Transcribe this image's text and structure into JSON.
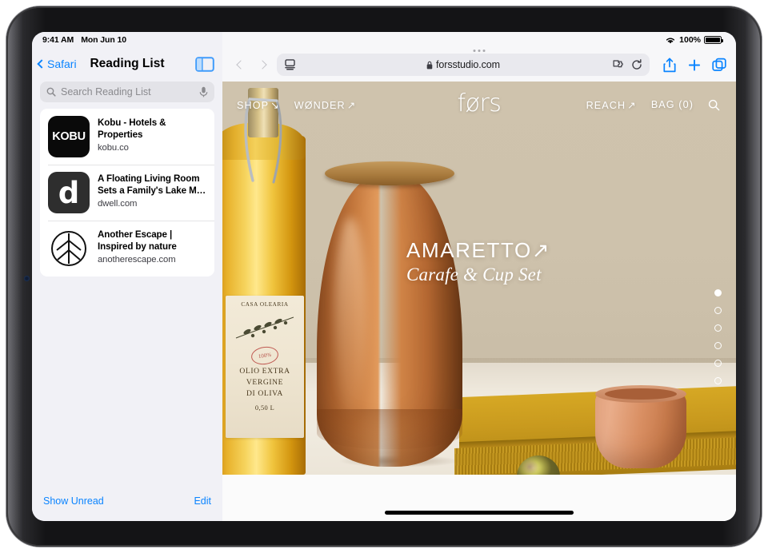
{
  "status_bar": {
    "time": "9:41 AM",
    "date": "Mon Jun 10",
    "battery_percent": "100%",
    "wifi_icon": "wifi-icon",
    "battery_icon": "battery-full-icon"
  },
  "sidebar": {
    "back_label": "Safari",
    "title": "Reading List",
    "toggle_icon": "sidebar-toggle-icon",
    "search": {
      "placeholder": "Search Reading List",
      "value": "",
      "search_icon": "magnifying-glass-icon",
      "dictation_icon": "microphone-icon"
    },
    "items": [
      {
        "title": "Kobu - Hotels & Properties",
        "url": "kobu.co",
        "favicon_text": "KOBU",
        "favicon_name": "kobu-favicon"
      },
      {
        "title": "A Floating Living Room Sets a Family's Lake M…",
        "url": "dwell.com",
        "favicon_text": "d",
        "favicon_name": "dwell-favicon"
      },
      {
        "title": "Another Escape | Inspired by nature",
        "url": "anotherescape.com",
        "favicon_text": "",
        "favicon_name": "another-escape-leaf-favicon"
      }
    ],
    "footer": {
      "show_unread": "Show Unread",
      "edit": "Edit"
    }
  },
  "browser_toolbar": {
    "back_icon": "chevron-left-icon",
    "forward_icon": "chevron-right-icon",
    "page_settings_icon": "aa-page-settings-icon",
    "url": "forsstudio.com",
    "lock_icon": "lock-icon",
    "extensions_icon": "puzzle-piece-icon",
    "reload_icon": "reload-icon",
    "share_icon": "share-icon",
    "new_tab_icon": "plus-icon",
    "tab_overview_icon": "tabs-icon"
  },
  "webpage": {
    "brand": "førs",
    "nav_left": [
      {
        "label": "SHOP",
        "arrow": "↘"
      },
      {
        "label": "WØNDER",
        "arrow": "↗"
      }
    ],
    "nav_right": [
      {
        "label": "REACH",
        "arrow": "↗"
      },
      {
        "label": "BAG (0)",
        "arrow": ""
      }
    ],
    "search_icon": "site-search-icon",
    "hero": {
      "title": "AMARETTO",
      "title_arrow": "↗",
      "subtitle": "Carafe & Cup Set"
    },
    "carousel": {
      "total_dots": 6,
      "active_index": 0
    },
    "bottle_label": {
      "top": "CASA OLEARIA",
      "stamp": "100%",
      "line1": "OLIO EXTRA",
      "line2": "VERGINE",
      "line3": "DI OLIVA",
      "volume": "0,50 L"
    }
  },
  "colors": {
    "accent_blue": "#0a84ff",
    "sidebar_bg": "#f1f1f6",
    "hero_wall": "#cec2ac",
    "carafe_terracotta": "#c87b3f",
    "cloth_mustard": "#c99a1e",
    "cup_salmon": "#e0a07c"
  }
}
